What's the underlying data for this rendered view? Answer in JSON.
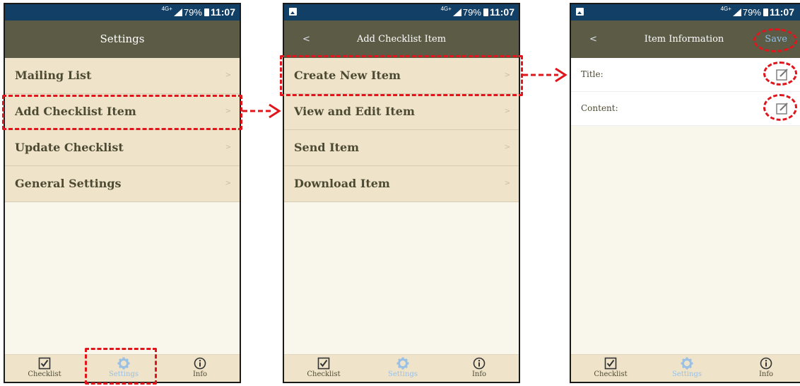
{
  "status_bar": {
    "network": "4G+",
    "battery": "79%",
    "time": "11:07"
  },
  "screen1": {
    "title": "Settings",
    "items": [
      {
        "label": "Mailing List",
        "chevron": ">"
      },
      {
        "label": "Add Checklist Item",
        "chevron": ">"
      },
      {
        "label": "Update Checklist",
        "chevron": ">"
      },
      {
        "label": "General Settings",
        "chevron": ">"
      }
    ]
  },
  "screen2": {
    "back": "<",
    "title": "Add Checklist Item",
    "items": [
      {
        "label": "Create New Item",
        "chevron": ">"
      },
      {
        "label": "View and Edit Item",
        "chevron": ">"
      },
      {
        "label": "Send Item",
        "chevron": ">"
      },
      {
        "label": "Download Item",
        "chevron": ">"
      }
    ]
  },
  "screen3": {
    "back": "<",
    "title": "Item Information",
    "save": "Save",
    "fields": [
      {
        "label": "Title:"
      },
      {
        "label": "Content:"
      }
    ]
  },
  "tabs": {
    "checklist": "Checklist",
    "settings": "Settings",
    "info": "Info",
    "active": "settings"
  },
  "colors": {
    "header": "#5c5b45",
    "status_bar": "#123f66",
    "row": "#efe4c9",
    "background": "#f9f6ec",
    "highlight": "#e0161c",
    "active_tab": "#9ac0e6"
  },
  "icons": [
    "checkbox-icon",
    "gear-icon",
    "info-icon",
    "edit-icon",
    "picture-icon",
    "signal-icon",
    "battery-icon"
  ]
}
